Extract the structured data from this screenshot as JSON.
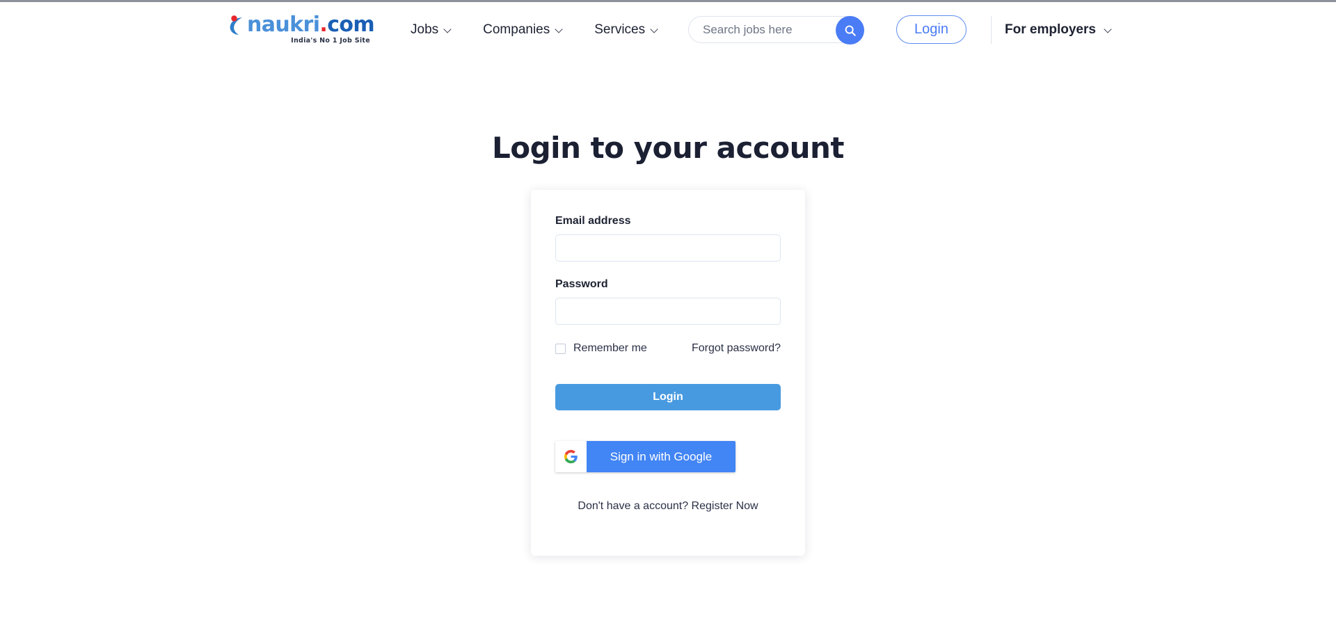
{
  "brand": {
    "logo_text_main": "naukri",
    "logo_text_dot": ".",
    "logo_text_com": "com",
    "tagline": "India's No 1 Job Site",
    "logo_blue": "#4a90d9",
    "logo_red": "#e8262c",
    "logo_darkblue": "#1a5fb4"
  },
  "header": {
    "nav": [
      {
        "label": "Jobs",
        "icon": "chevron-down-icon"
      },
      {
        "label": "Companies",
        "icon": "chevron-down-icon"
      },
      {
        "label": "Services",
        "icon": "chevron-down-icon"
      }
    ],
    "search": {
      "placeholder": "Search jobs here",
      "value": "",
      "button_icon": "search-icon",
      "button_color": "#4a7cf5"
    },
    "login_button": "Login",
    "login_color": "#4a7cf5",
    "employers": {
      "label": "For employers",
      "icon": "chevron-down-icon"
    }
  },
  "main": {
    "title": "Login to your account",
    "form": {
      "email": {
        "label": "Email address",
        "value": "",
        "placeholder": ""
      },
      "password": {
        "label": "Password",
        "value": "",
        "placeholder": ""
      },
      "remember_me": {
        "label": "Remember me",
        "checked": false
      },
      "forgot_password": "Forgot password?",
      "submit": {
        "label": "Login",
        "color": "#489ae0"
      },
      "google": {
        "label": "Sign in with Google",
        "icon": "google-g-icon",
        "color": "#4285f4"
      },
      "register": "Don't have a account? Register Now"
    }
  }
}
